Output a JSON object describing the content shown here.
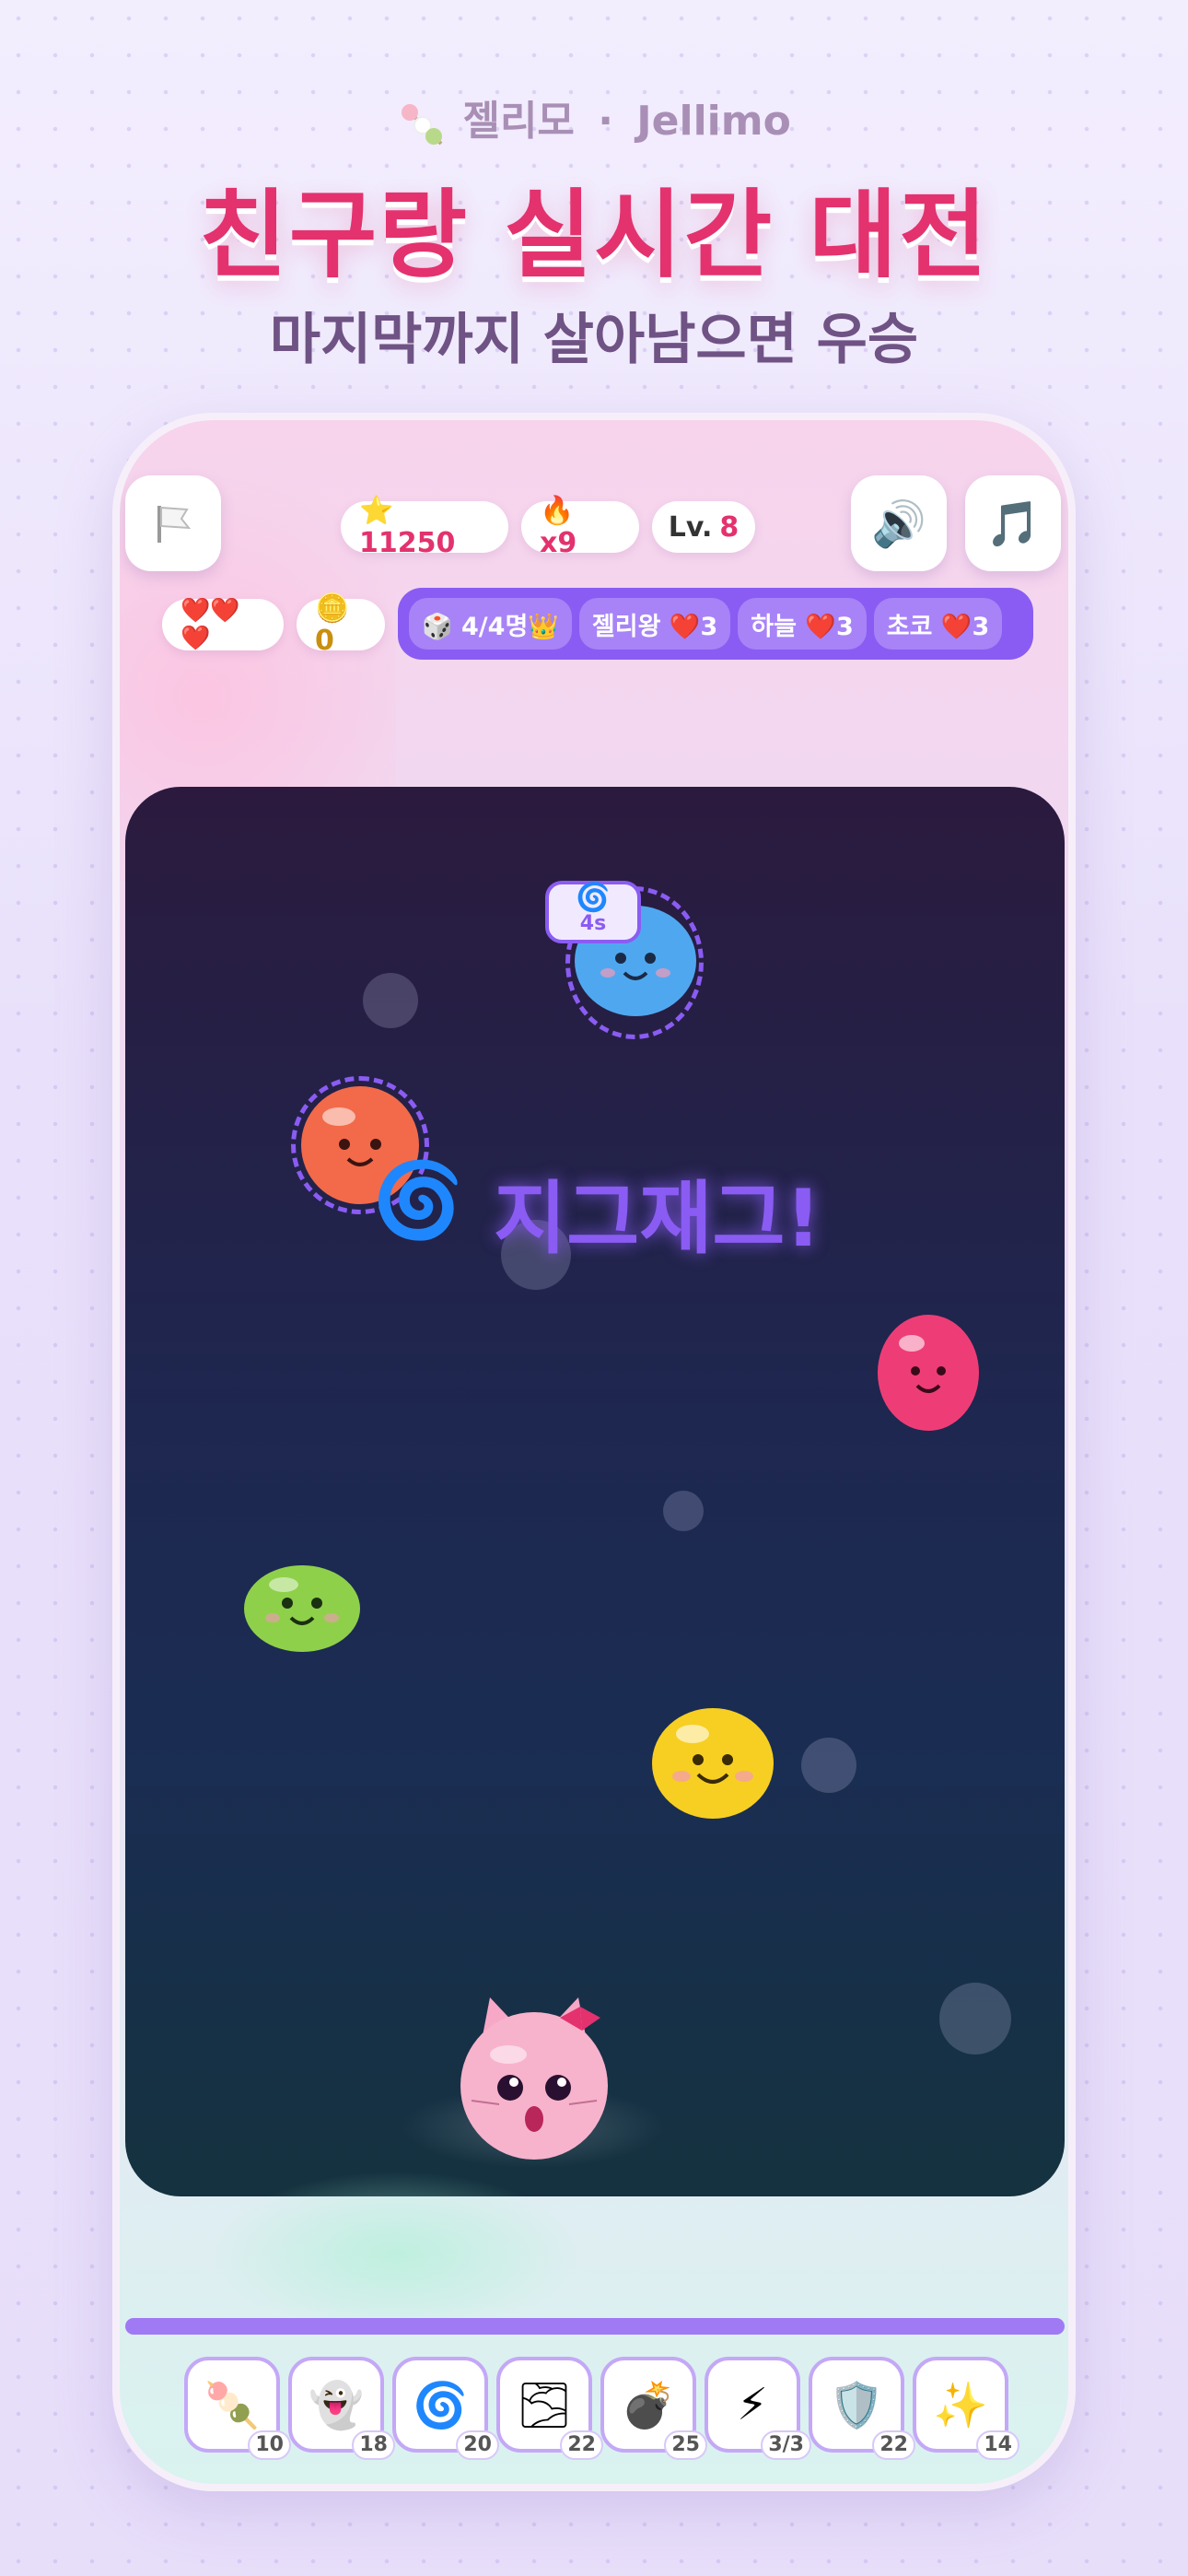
{
  "header": {
    "brand_ko": "젤리모",
    "brand_sep": "·",
    "brand_en": "Jellimo",
    "headline": "친구랑 실시간 대전",
    "subhead": "마지막까지 살아남으면 우승"
  },
  "hud": {
    "flag_icon": "white-flag-icon",
    "score": "⭐ 11250",
    "combo": "🔥 x9",
    "level_label": "Lv.",
    "level_value": "8",
    "sound_icon": "speaker-icon",
    "music_icon": "music-note-icon",
    "lives": "❤️❤️❤️",
    "coins": "🪙 0"
  },
  "players": {
    "room": "🎲 4/4명👑",
    "list": [
      {
        "label": "젤리왕 ❤️3"
      },
      {
        "label": "하늘 ❤️3"
      },
      {
        "label": "초코 ❤️3"
      }
    ]
  },
  "arena": {
    "effect_icon": "🌀",
    "effect_text": "지그재그!",
    "timer_icon": "🌀",
    "timer_value": "4s"
  },
  "items": [
    {
      "icon": "dango-icon",
      "glyph": "🍡",
      "count": "10"
    },
    {
      "icon": "ghost-icon",
      "glyph": "👻",
      "count": "18"
    },
    {
      "icon": "swirl-icon",
      "glyph": "🌀",
      "count": "20"
    },
    {
      "icon": "wind-icon",
      "glyph": "🌫",
      "count": "22"
    },
    {
      "icon": "bomb-icon",
      "glyph": "💣",
      "count": "25"
    },
    {
      "icon": "lightning-icon",
      "glyph": "⚡",
      "count": "3/3"
    },
    {
      "icon": "shield-icon",
      "glyph": "🛡️",
      "count": "22"
    },
    {
      "icon": "sparkles-icon",
      "glyph": "✨",
      "count": "14"
    }
  ],
  "colors": {
    "accent_pink": "#e3326e",
    "accent_purple": "#8a5cf3",
    "text_purple": "#6f5384"
  }
}
